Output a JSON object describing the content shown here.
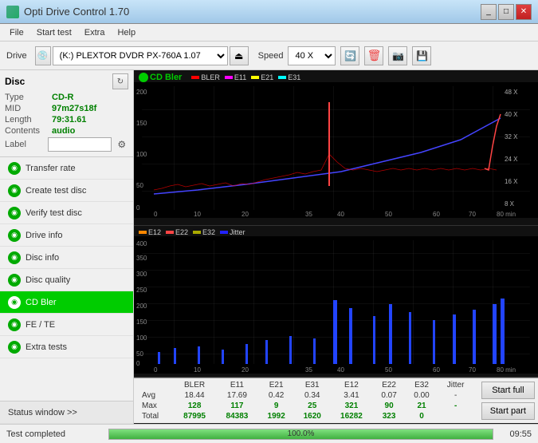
{
  "titlebar": {
    "title": "Opti Drive Control 1.70",
    "icon": "disc-icon",
    "controls": {
      "minimize": "_",
      "maximize": "□",
      "close": "✕"
    }
  },
  "menubar": {
    "items": [
      "File",
      "Start test",
      "Extra",
      "Help"
    ]
  },
  "toolbar": {
    "drive_label": "Drive",
    "drive_value": "(K:)  PLEXTOR DVDR  PX-760A 1.07",
    "speed_label": "Speed",
    "speed_value": "40 X"
  },
  "disc": {
    "title": "Disc",
    "fields": [
      {
        "key": "Type",
        "value": "CD-R"
      },
      {
        "key": "MID",
        "value": "97m27s18f"
      },
      {
        "key": "Length",
        "value": "79:31.61"
      },
      {
        "key": "Contents",
        "value": "audio"
      },
      {
        "key": "Label",
        "value": ""
      }
    ]
  },
  "nav": {
    "items": [
      {
        "id": "transfer-rate",
        "label": "Transfer rate",
        "active": false
      },
      {
        "id": "create-test-disc",
        "label": "Create test disc",
        "active": false
      },
      {
        "id": "verify-test-disc",
        "label": "Verify test disc",
        "active": false
      },
      {
        "id": "drive-info",
        "label": "Drive info",
        "active": false
      },
      {
        "id": "disc-info",
        "label": "Disc info",
        "active": false
      },
      {
        "id": "disc-quality",
        "label": "Disc quality",
        "active": false
      },
      {
        "id": "cd-bler",
        "label": "CD Bler",
        "active": true
      },
      {
        "id": "fe-te",
        "label": "FE / TE",
        "active": false
      },
      {
        "id": "extra-tests",
        "label": "Extra tests",
        "active": false
      }
    ]
  },
  "sidebar_bottom": {
    "status_window": "Status window >>",
    "fe_te": "FE / TE"
  },
  "chart_top": {
    "title": "CD Bler",
    "legend": [
      {
        "label": "BLER",
        "color": "#ff0000"
      },
      {
        "label": "E11",
        "color": "#ff00ff"
      },
      {
        "label": "E21",
        "color": "#ffff00"
      },
      {
        "label": "E31",
        "color": "#00ffff"
      }
    ],
    "y_max": 200,
    "y_labels": [
      "200",
      "150",
      "100",
      "50",
      "0"
    ],
    "y_right_labels": [
      "48 X",
      "40 X",
      "32 X",
      "24 X",
      "16 X",
      "8 X"
    ],
    "x_labels": [
      "0",
      "10",
      "20",
      "35",
      "40",
      "50",
      "60",
      "70",
      "80"
    ]
  },
  "chart_bottom": {
    "legend": [
      {
        "label": "E12",
        "color": "#ff8800"
      },
      {
        "label": "E22",
        "color": "#ff0000"
      },
      {
        "label": "E32",
        "color": "#888800"
      },
      {
        "label": "Jitter",
        "color": "#0000ff"
      }
    ],
    "y_max": 400,
    "y_labels": [
      "400",
      "350",
      "300",
      "250",
      "200",
      "150",
      "100",
      "50",
      "0"
    ],
    "x_labels": [
      "0",
      "10",
      "20",
      "35",
      "40",
      "50",
      "60",
      "70",
      "80"
    ]
  },
  "data_table": {
    "headers": [
      "",
      "BLER",
      "E11",
      "E21",
      "E31",
      "E12",
      "E22",
      "E32",
      "Jitter"
    ],
    "rows": [
      {
        "label": "Avg",
        "values": [
          "18.44",
          "17.69",
          "0.42",
          "0.34",
          "3.41",
          "0.07",
          "0.00",
          "-"
        ]
      },
      {
        "label": "Max",
        "values": [
          "128",
          "117",
          "9",
          "25",
          "321",
          "90",
          "21",
          "-"
        ]
      },
      {
        "label": "Total",
        "values": [
          "87995",
          "84383",
          "1992",
          "1620",
          "16282",
          "323",
          "0",
          ""
        ]
      }
    ]
  },
  "action_buttons": {
    "start_full": "Start full",
    "start_part": "Start part"
  },
  "statusbar": {
    "status_text": "Test completed",
    "progress_percent": 100,
    "progress_label": "100.0%",
    "time": "09:55"
  }
}
